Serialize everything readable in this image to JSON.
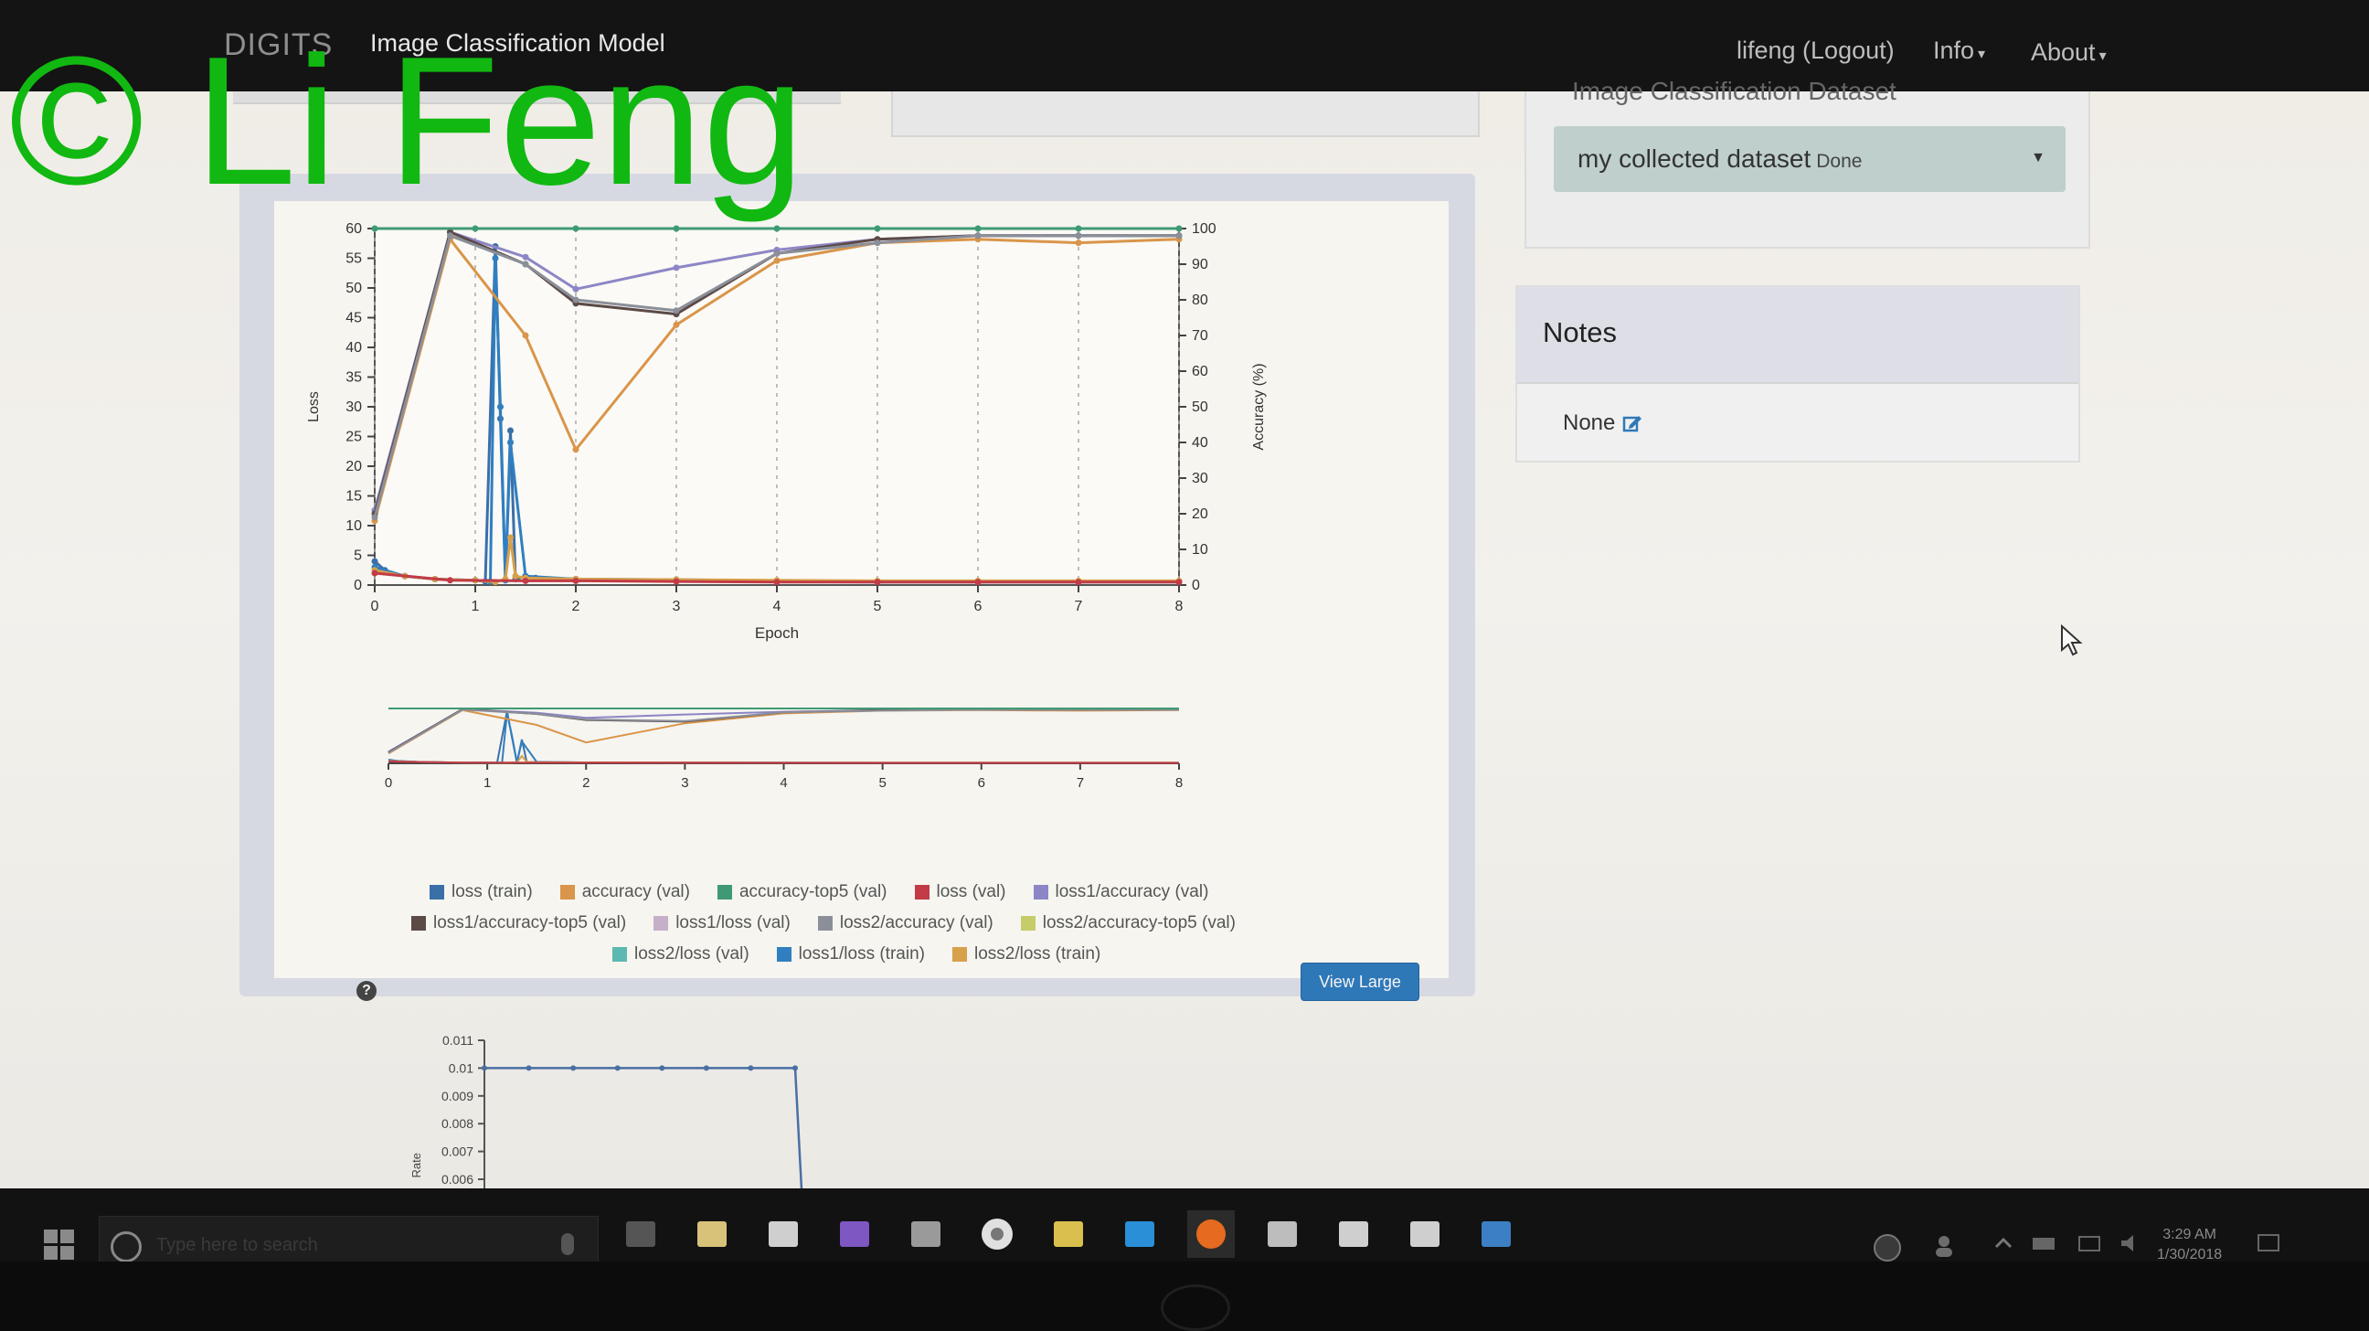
{
  "navbar": {
    "brand": "DIGITS",
    "title": "Image Classification Model",
    "user": "lifeng (Logout)",
    "info": "Info",
    "about": "About"
  },
  "dataset_panel": {
    "heading": "Image Classification Dataset",
    "selected": "my collected dataset",
    "status": "Done"
  },
  "notes": {
    "title": "Notes",
    "value": "None"
  },
  "view_large_label": "View Large",
  "help_glyph": "?",
  "watermark": "© Li Feng",
  "taskbar": {
    "search_placeholder": "Type here to search",
    "time": "3:29 AM",
    "date": "1/30/2018",
    "apps": [
      "task-view-icon",
      "file-explorer-icon",
      "store-bag-icon",
      "visual-studio-icon",
      "calculator-icon",
      "chrome-icon",
      "puzzle-app-icon",
      "edge-icon",
      "firefox-icon",
      "photo-app-icon",
      "document-app-icon",
      "pdf-app-icon",
      "remote-app-icon"
    ]
  },
  "colors": {
    "navbar": "#141414",
    "accent_button": "#2f78b8",
    "watermark": "#11b811"
  },
  "legend": [
    {
      "label": "loss (train)",
      "color": "#3b6fa8"
    },
    {
      "label": "accuracy (val)",
      "color": "#d9954a"
    },
    {
      "label": "accuracy-top5 (val)",
      "color": "#3f9a74"
    },
    {
      "label": "loss (val)",
      "color": "#c23b46"
    },
    {
      "label": "loss1/accuracy (val)",
      "color": "#8d86c6"
    },
    {
      "label": "loss1/accuracy-top5 (val)",
      "color": "#5c4a47"
    },
    {
      "label": "loss1/loss (val)",
      "color": "#c6b0c9"
    },
    {
      "label": "loss2/accuracy (val)",
      "color": "#8a8f99"
    },
    {
      "label": "loss2/accuracy-top5 (val)",
      "color": "#c7cc6a"
    },
    {
      "label": "loss2/loss (val)",
      "color": "#5cb8b0"
    },
    {
      "label": "loss1/loss (train)",
      "color": "#2f7fc1"
    },
    {
      "label": "loss2/loss (train)",
      "color": "#d7a04a"
    }
  ],
  "chart_data": [
    {
      "type": "line",
      "xlabel": "Epoch",
      "ylabel": "Loss",
      "y2label": "Accuracy (%)",
      "xlim": [
        0,
        8
      ],
      "ylim": [
        0,
        60
      ],
      "y2lim": [
        0,
        100
      ],
      "xticks": [
        0,
        1,
        2,
        3,
        4,
        5,
        6,
        7,
        8
      ],
      "yticks": [
        0,
        5,
        10,
        15,
        20,
        25,
        30,
        35,
        40,
        45,
        50,
        55,
        60
      ],
      "y2ticks": [
        0,
        10,
        20,
        30,
        40,
        50,
        60,
        70,
        80,
        90,
        100
      ],
      "legend_position": "bottom",
      "series": [
        {
          "name": "loss (train)",
          "axis": "left",
          "x": [
            0,
            0.1,
            0.3,
            0.6,
            1.0,
            1.1,
            1.2,
            1.25,
            1.3,
            1.35,
            1.4,
            1.5,
            1.6,
            2,
            3,
            4,
            5,
            6,
            7,
            8
          ],
          "values": [
            4,
            2.5,
            1.5,
            1,
            0.8,
            0.6,
            57,
            28,
            0.8,
            26,
            1,
            1.5,
            1.2,
            1,
            0.8,
            0.6,
            0.5,
            0.5,
            0.5,
            0.5
          ]
        },
        {
          "name": "loss1/loss (train)",
          "axis": "left",
          "x": [
            0,
            0.3,
            0.6,
            1.0,
            1.15,
            1.2,
            1.25,
            1.3,
            1.35,
            1.5,
            2,
            3,
            4,
            5,
            6,
            7,
            8
          ],
          "values": [
            3,
            1.5,
            1,
            0.8,
            0.6,
            55,
            30,
            0.8,
            24,
            1.5,
            1,
            0.9,
            0.7,
            0.6,
            0.6,
            0.6,
            0.6
          ]
        },
        {
          "name": "loss2/loss (train)",
          "axis": "left",
          "x": [
            0,
            0.3,
            0.6,
            1.0,
            1.2,
            1.3,
            1.35,
            1.4,
            1.5,
            2,
            3,
            4,
            5,
            6,
            7,
            8
          ],
          "values": [
            2.5,
            1.5,
            1,
            0.8,
            0.5,
            1,
            8,
            1.5,
            1.2,
            1,
            0.9,
            0.8,
            0.7,
            0.7,
            0.7,
            0.7
          ]
        },
        {
          "name": "accuracy (val)",
          "axis": "right",
          "x": [
            0,
            0.75,
            1.5,
            2,
            3,
            4,
            5,
            6,
            7,
            8
          ],
          "values": [
            18,
            97,
            70,
            38,
            73,
            91,
            96,
            97,
            96,
            97
          ]
        },
        {
          "name": "loss1/accuracy (val)",
          "axis": "right",
          "x": [
            0,
            0.75,
            1.5,
            2,
            3,
            4,
            5,
            6,
            7,
            8
          ],
          "values": [
            21,
            99,
            92,
            83,
            89,
            94,
            97,
            98,
            98,
            98
          ]
        },
        {
          "name": "loss1/accuracy-top5 (val)",
          "axis": "right",
          "x": [
            0,
            0.75,
            1.5,
            2,
            3,
            4,
            5,
            6,
            7,
            8
          ],
          "values": [
            20,
            99,
            90,
            79,
            76,
            93,
            97,
            98,
            98,
            98
          ]
        },
        {
          "name": "loss2/accuracy (val)",
          "axis": "right",
          "x": [
            0,
            0.75,
            1.5,
            2,
            3,
            4,
            5,
            6,
            7,
            8
          ],
          "values": [
            19,
            98,
            90,
            80,
            77,
            93,
            96,
            98,
            98,
            98
          ]
        },
        {
          "name": "accuracy-top5 (val)",
          "axis": "right",
          "x": [
            0,
            1,
            2,
            3,
            4,
            5,
            6,
            7,
            8
          ],
          "values": [
            100,
            100,
            100,
            100,
            100,
            100,
            100,
            100,
            100
          ]
        },
        {
          "name": "loss (val)",
          "axis": "left",
          "x": [
            0,
            0.75,
            1.5,
            2,
            3,
            4,
            5,
            6,
            7,
            8
          ],
          "values": [
            2,
            0.8,
            0.7,
            0.7,
            0.6,
            0.5,
            0.5,
            0.5,
            0.5,
            0.5
          ]
        }
      ]
    },
    {
      "type": "line",
      "role": "overview",
      "xticks": [
        0,
        1,
        2,
        3,
        4,
        5,
        6,
        7,
        8
      ]
    },
    {
      "type": "line",
      "ylabel": "Rate",
      "yticks": [
        0.006,
        0.007,
        0.008,
        0.009,
        0.01,
        0.011
      ],
      "series": [
        {
          "name": "learning rate",
          "x": [
            0,
            0.5,
            1,
            1.5,
            2,
            2.5,
            3,
            3.5
          ],
          "values": [
            0.01,
            0.01,
            0.01,
            0.01,
            0.01,
            0.01,
            0.01,
            0.01
          ]
        }
      ]
    }
  ]
}
